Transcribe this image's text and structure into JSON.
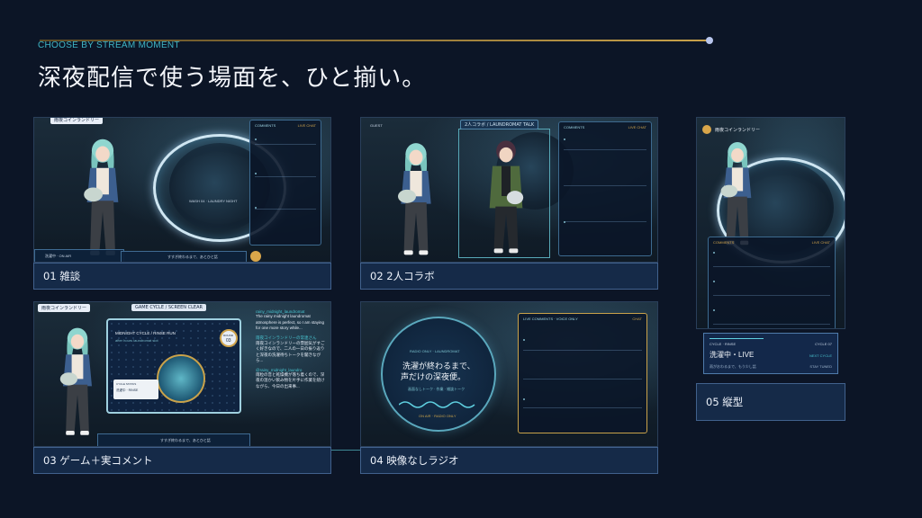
{
  "header": {
    "eyebrow": "CHOOSE BY STREAM MOMENT",
    "title": "深夜配信で使う場面を、ひと揃い。"
  },
  "cards": [
    {
      "caption": "01 雑談",
      "name_tag": "雨夜コインランドリー",
      "comments_header": "COMMENTS",
      "comments_header_right": "LIVE CHAT",
      "drum_label": "WASH 04 · LAUNDRY NIGHT",
      "status_tag": "洗濯中 · ON AIR",
      "ticker": "すすぎ終わるまで、あとひと話"
    },
    {
      "caption": "02 2人コラボ",
      "top_tag": "2人コラボ / LAUNDROMAT TALK",
      "guest_tag": "GUEST",
      "comments_header": "COMMENTS",
      "comments_header_right": "LIVE CHAT"
    },
    {
      "caption": "03 ゲーム＋実コメント",
      "name_tag": "雨夜コインランドリー",
      "game_header": "GAME CYCLE / SCREEN CLEAR",
      "game_title": "MIDNIGHT CYCLE / RINSE RUN",
      "game_sub": "after hours laundromat slot",
      "round_label": "ROUND",
      "round_value": "03",
      "cycle_status_label": "CYCLE STATUS",
      "cycle_status_value": "洗濯中 · RINSE",
      "ticker": "すすぎ終わるまで、あとひと話",
      "comments": [
        {
          "user": "rainy_midnight_laundromat",
          "text": "The rainy midnight laundromat atmosphere is perfect, so I am staying for one more story while..."
        },
        {
          "user": "雨夜コインランドリーの常連さん",
          "text": "雨夜コインランドリーの雰囲気がすごく好きなので、二人の一日の振り返りと深夜の洗濯待ちトークを聞きながら..."
        },
        {
          "user": "@rainy_midnight_laundro",
          "text": "雨粒の音と乾燥機が落ち着くので、深夜の温かい飲み物を片手に作業を続けながら、今日の出来事..."
        }
      ]
    },
    {
      "caption": "04 映像なしラジオ",
      "radio_small": "RADIO ONLY · LAUNDROMAT",
      "radio_main_1": "洗濯が終わるまで、",
      "radio_main_2": "声だけの深夜便。",
      "radio_sub": "画面なしトーク · 作業 · 雑談トーク",
      "radio_foot": "ON AIR · RADIO ONLY",
      "comments_header": "LIVE COMMENTS · VOICE ONLY",
      "comments_header_right": "CHAT"
    },
    {
      "caption": "05 縦型",
      "name_tag": "雨夜コインランドリー",
      "comments_header": "COMMENTS",
      "comments_header_right": "LIVE CHAT",
      "cycle_label": "CYCLE · RINSE",
      "cycle_right": "CYCLE 07",
      "live_text": "洗濯中・LIVE",
      "next_cycle": "NEXT CYCLE",
      "live_sub": "雨がおわるまで、もう少し話",
      "live_sub_right": "STAY TUNED"
    }
  ],
  "colors": {
    "background": "#0c1526",
    "accent_teal": "#3fb6c6",
    "accent_gold": "#c9a24a",
    "caption_bg": "#152a48"
  }
}
